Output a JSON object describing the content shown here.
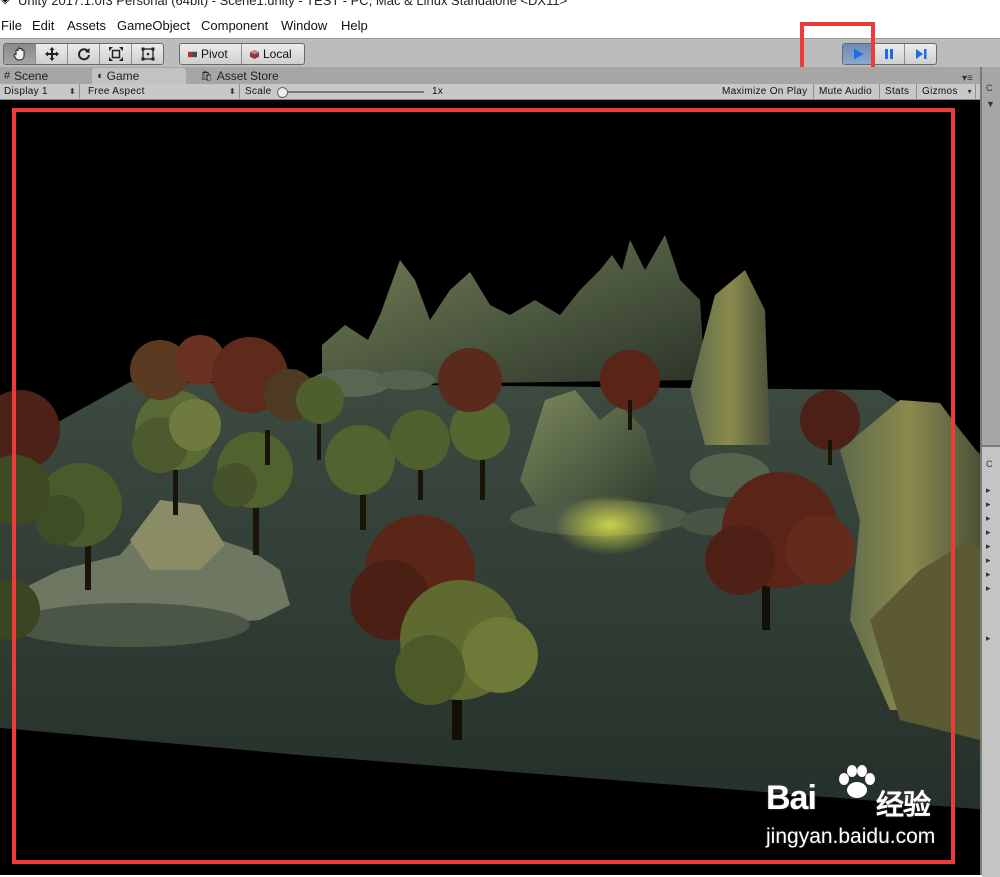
{
  "window": {
    "title": "Unity 2017.1.0f3 Personal (64bit) - Scene1.unity - TEST - PC, Mac & Linux Standalone <DX11>"
  },
  "menu": [
    "File",
    "Edit",
    "Assets",
    "GameObject",
    "Component",
    "Window",
    "Help"
  ],
  "toolbar": {
    "tools": [
      "hand-icon",
      "move-icon",
      "rotate-icon",
      "scale-icon",
      "rect-icon"
    ],
    "pivot_label": "Pivot",
    "local_label": "Local",
    "play_buttons": [
      "play-icon",
      "pause-icon",
      "step-icon"
    ],
    "play_active": true
  },
  "tabs": {
    "scene": "Scene",
    "game": "Game",
    "asset_store": "Asset Store",
    "active": "Game"
  },
  "gamebar": {
    "display": "Display 1",
    "aspect": "Free Aspect",
    "scale_label": "Scale",
    "scale_value": "1x",
    "scale_level": 0.0,
    "maximize": "Maximize On Play",
    "mute": "Mute Audio",
    "stats": "Stats",
    "gizmos": "Gizmos"
  },
  "right_panel": {
    "top_tab": "C",
    "lower_tab": "C"
  },
  "watermark": {
    "logo": "Bai",
    "logo_cn": "经验",
    "url": "jingyan.baidu.com"
  },
  "colors": {
    "highlight": "#ec3b3b",
    "play_active": "#6c8cb6",
    "toolbar_bg": "#bcbcbc",
    "viewport_bg": "#000000"
  }
}
